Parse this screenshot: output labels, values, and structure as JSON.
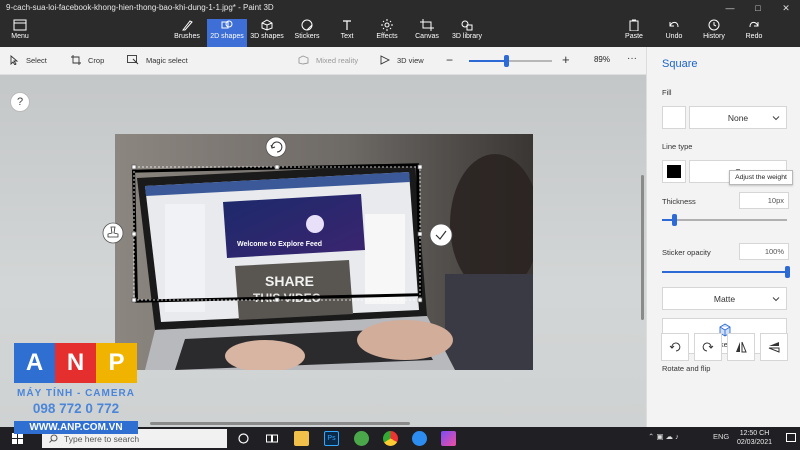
{
  "window": {
    "title": "9-cach-sua-loi-facebook-khong-hien-thong-bao-khi-dung-1-1.jpg* - Paint 3D",
    "controls": [
      "minimize",
      "maximize",
      "close"
    ]
  },
  "ribbon": {
    "menu_label": "Menu",
    "tools": [
      {
        "label": "Brushes",
        "icon": "brush-icon"
      },
      {
        "label": "2D shapes",
        "icon": "2d-shapes-icon",
        "active": true
      },
      {
        "label": "3D shapes",
        "icon": "3d-shapes-icon"
      },
      {
        "label": "Stickers",
        "icon": "stickers-icon"
      },
      {
        "label": "Text",
        "icon": "text-icon"
      },
      {
        "label": "Effects",
        "icon": "effects-icon"
      },
      {
        "label": "Canvas",
        "icon": "canvas-icon"
      },
      {
        "label": "3D library",
        "icon": "3d-library-icon"
      }
    ],
    "actions": [
      {
        "label": "Paste",
        "icon": "paste-icon"
      },
      {
        "label": "Undo",
        "icon": "undo-icon"
      },
      {
        "label": "History",
        "icon": "history-icon"
      },
      {
        "label": "Redo",
        "icon": "redo-icon"
      }
    ],
    "active_color": "#3e6fd6"
  },
  "toolbar": {
    "select_label": "Select",
    "crop_label": "Crop",
    "magic_select_label": "Magic select",
    "mixed_reality_label": "Mixed reality",
    "view_3d_label": "3D view",
    "zoom_value": "89%",
    "zoom_level": 0.45,
    "more_label": "···"
  },
  "canvas": {
    "help_label": "?",
    "image_description_visible": {
      "post_title": "Welcome to Explore Feed",
      "video_text_line1": "SHARE",
      "video_text_line2": "THIS VIDEO"
    }
  },
  "panel": {
    "title": "Square",
    "fill_label": "Fill",
    "fill_value": "None",
    "line_type_label": "Line type",
    "line_type_value": "S",
    "tooltip": "Adjust the weight",
    "thickness_label": "Thickness",
    "thickness_value": "10px",
    "thickness_level": 0.1,
    "sticker_opacity_label": "Sticker opacity",
    "sticker_opacity_value": "100%",
    "sticker_opacity_level": 1.0,
    "finish_value": "Matte",
    "make_3d_label": "Make 3D",
    "rotate_flip_label": "Rotate and flip",
    "accent": "#1c64c8"
  },
  "taskbar": {
    "search_placeholder": "Type here to search",
    "language": "ENG",
    "time": "12:50 CH",
    "date": "02/03/2021"
  },
  "watermark": {
    "letters": [
      "A",
      "N",
      "P"
    ],
    "tagline": "MÁY TÍNH - CAMERA",
    "phone": "098 772 0 772",
    "website": "WWW.ANP.COM.VN",
    "colors": [
      "#2f6fd1",
      "#e52f2f",
      "#f0b400"
    ]
  }
}
